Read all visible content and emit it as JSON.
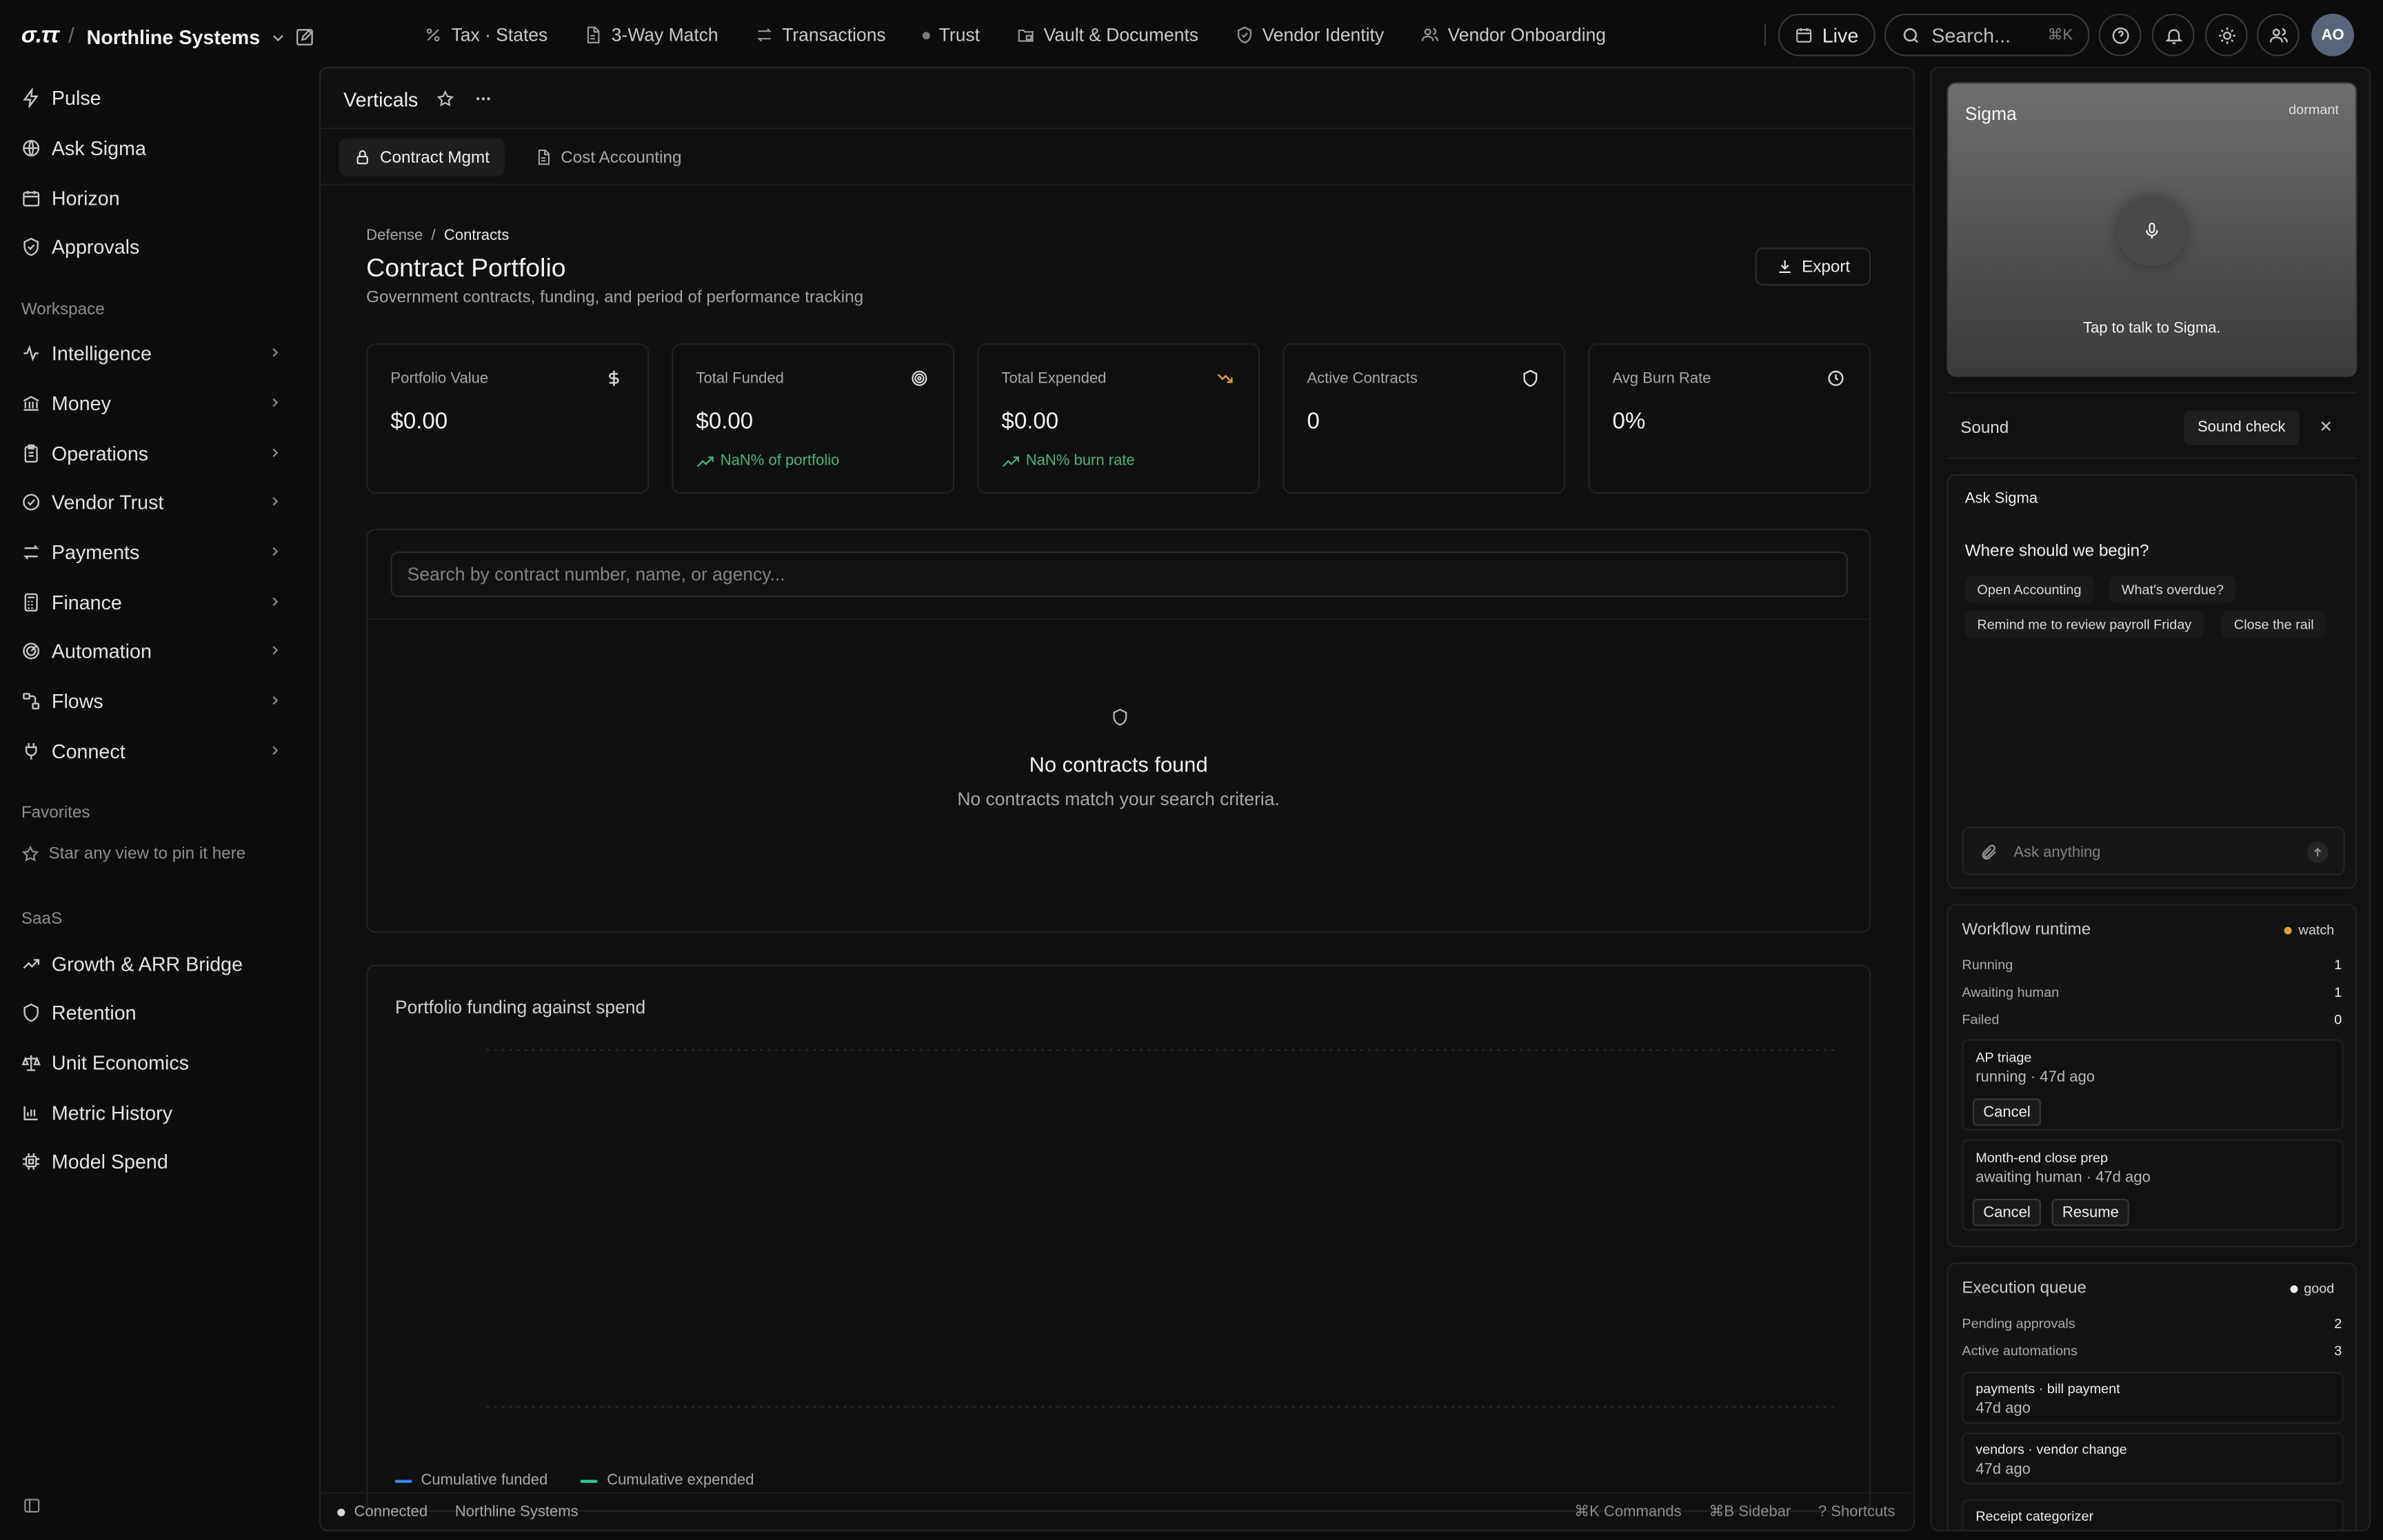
{
  "app": {
    "logo": "σ.ττ",
    "org": "Northline Systems"
  },
  "topnav": [
    {
      "label": "Tax · States",
      "icon": "percent-icon"
    },
    {
      "label": "3-Way Match",
      "icon": "document-icon"
    },
    {
      "label": "Transactions",
      "icon": "arrows-icon"
    },
    {
      "label": "Trust",
      "icon": "dot-icon"
    },
    {
      "label": "Vault & Documents",
      "icon": "folder-lock-icon"
    },
    {
      "label": "Vendor Identity",
      "icon": "shield-check-icon"
    },
    {
      "label": "Vendor Onboarding",
      "icon": "users-icon"
    }
  ],
  "top": {
    "live": "Live",
    "search": "Search...",
    "search_kbd": "⌘K",
    "avatar": "AO"
  },
  "sidebar": {
    "primary": [
      {
        "label": "Pulse",
        "icon": "bolt-icon"
      },
      {
        "label": "Ask Sigma",
        "icon": "globe-icon"
      },
      {
        "label": "Horizon",
        "icon": "calendar-icon"
      },
      {
        "label": "Approvals",
        "icon": "shield-check-icon"
      }
    ],
    "workspace_heading": "Workspace",
    "workspace": [
      {
        "label": "Intelligence",
        "icon": "activity-icon"
      },
      {
        "label": "Money",
        "icon": "bank-icon"
      },
      {
        "label": "Operations",
        "icon": "clipboard-icon"
      },
      {
        "label": "Vendor Trust",
        "icon": "badge-check-icon"
      },
      {
        "label": "Payments",
        "icon": "transfer-icon"
      },
      {
        "label": "Finance",
        "icon": "calculator-icon"
      },
      {
        "label": "Automation",
        "icon": "radar-icon"
      },
      {
        "label": "Flows",
        "icon": "workflow-icon"
      },
      {
        "label": "Connect",
        "icon": "plug-icon"
      }
    ],
    "favorites_heading": "Favorites",
    "favorites_hint": "Star any view to pin it here",
    "saas_heading": "SaaS",
    "saas": [
      {
        "label": "Growth & ARR Bridge",
        "icon": "trending-up-icon"
      },
      {
        "label": "Retention",
        "icon": "shield-icon"
      },
      {
        "label": "Unit Economics",
        "icon": "scale-icon"
      },
      {
        "label": "Metric History",
        "icon": "bar-chart-icon"
      },
      {
        "label": "Model Spend",
        "icon": "cpu-icon"
      }
    ]
  },
  "main": {
    "title": "Verticals",
    "tabs": [
      {
        "label": "Contract Mgmt",
        "active": true
      },
      {
        "label": "Cost Accounting",
        "active": false
      }
    ],
    "breadcrumb": {
      "parent": "Defense",
      "sep": "/",
      "current": "Contracts"
    },
    "page_title": "Contract Portfolio",
    "page_subtitle": "Government contracts, funding, and period of performance tracking",
    "export_label": "Export",
    "stats": [
      {
        "label": "Portfolio Value",
        "value": "$0.00",
        "icon": "dollar-icon",
        "trend": ""
      },
      {
        "label": "Total Funded",
        "value": "$0.00",
        "icon": "target-icon",
        "trend": "NaN% of portfolio"
      },
      {
        "label": "Total Expended",
        "value": "$0.00",
        "icon": "trending-down-icon",
        "trend": "NaN% burn rate"
      },
      {
        "label": "Active Contracts",
        "value": "0",
        "icon": "shield-icon",
        "trend": ""
      },
      {
        "label": "Avg Burn Rate",
        "value": "0%",
        "icon": "clock-icon",
        "trend": ""
      }
    ],
    "search_placeholder": "Search by contract number, name, or agency...",
    "search_value": "",
    "empty_title": "No contracts found",
    "empty_subtitle": "No contracts match your search criteria.",
    "chart": {
      "title": "Portfolio funding against spend",
      "legend": [
        {
          "name": "Cumulative funded",
          "color": "#3b82f6"
        },
        {
          "name": "Cumulative expended",
          "color": "#34c38f"
        }
      ]
    }
  },
  "chart_data": {
    "type": "line",
    "title": "Portfolio funding against spend",
    "x": [],
    "series": [
      {
        "name": "Cumulative funded",
        "values": []
      },
      {
        "name": "Cumulative expended",
        "values": []
      }
    ],
    "grid": true,
    "legend_position": "bottom-left"
  },
  "status": {
    "connected": "Connected",
    "org": "Northline Systems",
    "shortcuts": [
      "⌘K Commands",
      "⌘B Sidebar",
      "? Shortcuts"
    ]
  },
  "rail": {
    "sigma_title": "Sigma",
    "sigma_status": "dormant",
    "sigma_tap": "Tap to talk to Sigma.",
    "sound_label": "Sound",
    "sound_check": "Sound check",
    "ask_title": "Ask Sigma",
    "ask_question": "Where should we begin?",
    "chips": [
      "Open Accounting",
      "What's overdue?",
      "Remind me to review payroll Friday",
      "Close the rail"
    ],
    "ask_placeholder": "Ask anything",
    "workflow": {
      "title": "Workflow runtime",
      "badge": "watch",
      "badge_color": "#e0a03a",
      "rows": [
        {
          "label": "Running",
          "value": "1"
        },
        {
          "label": "Awaiting human",
          "value": "1"
        },
        {
          "label": "Failed",
          "value": "0"
        }
      ],
      "jobs": [
        {
          "name": "AP triage",
          "status": "running · 47d ago",
          "buttons": [
            "Cancel"
          ]
        },
        {
          "name": "Month-end close prep",
          "status": "awaiting human · 47d ago",
          "buttons": [
            "Cancel",
            "Resume"
          ]
        }
      ]
    },
    "queue": {
      "title": "Execution queue",
      "badge": "good",
      "badge_color": "#f0f0f0",
      "rows": [
        {
          "label": "Pending approvals",
          "value": "2"
        },
        {
          "label": "Active automations",
          "value": "3"
        }
      ],
      "jobs": [
        {
          "name": "payments · bill payment",
          "status": "47d ago"
        },
        {
          "name": "vendors · vendor change",
          "status": "47d ago"
        },
        {
          "name": "Receipt categorizer",
          "status": ""
        }
      ]
    }
  }
}
